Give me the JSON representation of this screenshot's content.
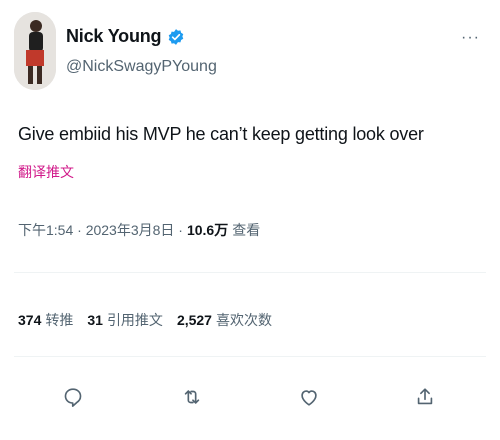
{
  "tweet": {
    "display_name": "Nick Young",
    "handle": "@NickSwagyPYoung",
    "more_label": "···",
    "text": "Give embiid his MVP he can’t keep getting look over",
    "translate_label": "翻译推文",
    "timestamp": "下午1:54 · 2023年3月8日 · ",
    "views_count": "10.6万",
    "views_label": "查看"
  },
  "stats": {
    "retweets": {
      "num": "374",
      "label": "转推"
    },
    "quotes": {
      "num": "31",
      "label": "引用推文"
    },
    "likes": {
      "num": "2,527",
      "label": "喜欢次数"
    }
  },
  "icons": {
    "reply": "reply-icon",
    "retweet": "retweet-icon",
    "like": "like-icon",
    "share": "share-icon",
    "verified": "verified-badge-icon"
  },
  "colors": {
    "primary_text": "#0f1419",
    "secondary_text": "#536471",
    "translate_link": "#d11a8a",
    "verified_blue": "#1d9bf0",
    "divider": "#eff3f4"
  }
}
